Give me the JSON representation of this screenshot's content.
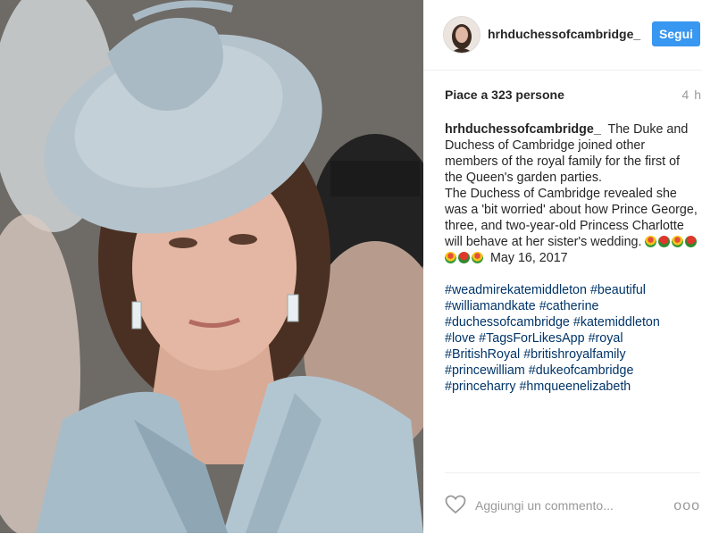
{
  "header": {
    "username": "hrhduchessofcambridge_",
    "follow_label": "Segui"
  },
  "meta": {
    "likes": "Piace a 323 persone",
    "time_ago": "4 h"
  },
  "caption": {
    "username": "hrhduchessofcambridge_",
    "text_1": "The Duke and Duchess of Cambridge joined other members of the royal family for the first of the Queen's garden parties.",
    "text_2": "The Duchess of Cambridge revealed she was a 'bit worried' about how Prince George, three, and two-year-old Princess Charlotte will behave at her sister's wedding.",
    "date": "May 16, 2017",
    "emoji_icons": [
      "bouquet",
      "rose",
      "bouquet",
      "rose",
      "bouquet",
      "rose",
      "bouquet"
    ]
  },
  "hashtags": [
    "#weadmirekatemiddleton",
    "#beautiful",
    "#williamandkate",
    "#catherine",
    "#duchessofcambridge",
    "#katemiddleton",
    "#love",
    "#TagsForLikesApp",
    "#royal",
    "#BritishRoyal",
    "#britishroyalfamily",
    "#princewilliam",
    "#dukeofcambridge",
    "#princeharry",
    "#hmqueenelizabeth"
  ],
  "footer": {
    "comment_placeholder": "Aggiungi un commento...",
    "more_label": "ooo",
    "like_icon": "heart-outline-icon",
    "more_icon": "more-options-icon"
  },
  "colors": {
    "accent": "#3897f0",
    "hashtag": "#003569",
    "muted": "#999999"
  }
}
